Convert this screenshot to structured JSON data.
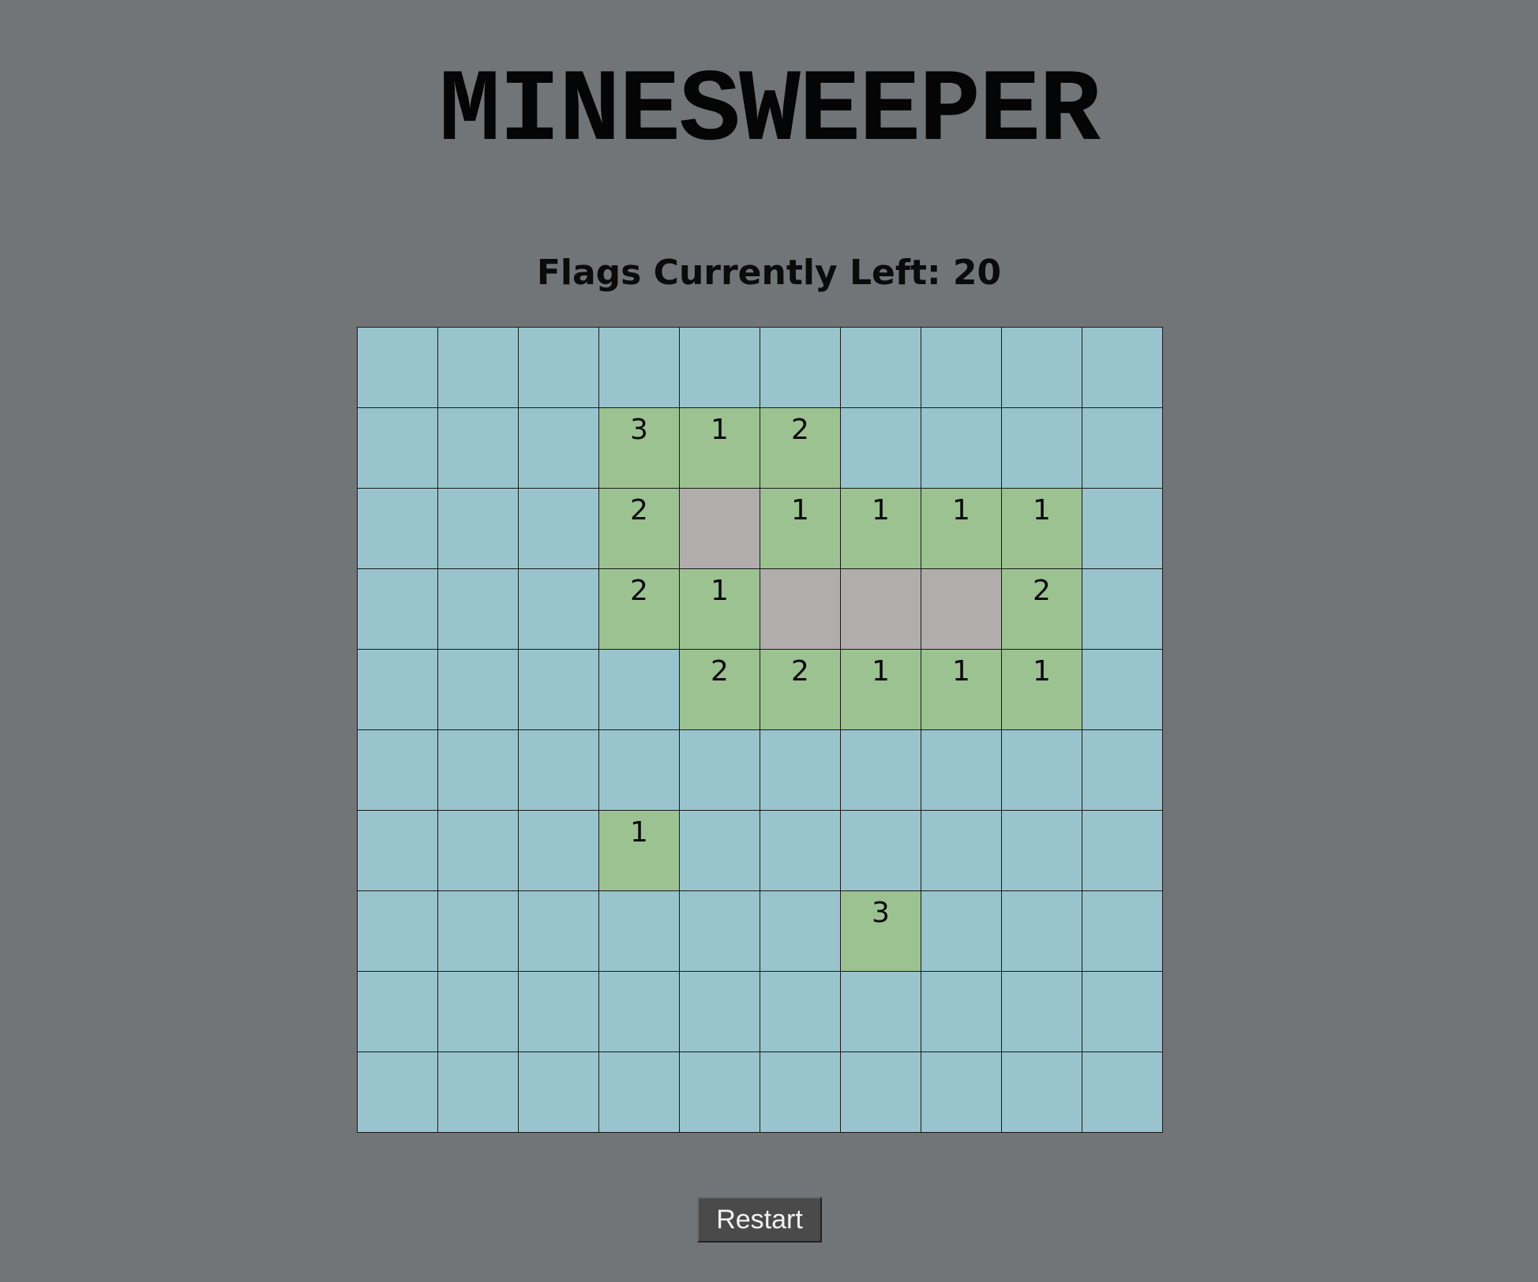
{
  "title": "MINESWEEPER",
  "flags_text": "Flags Currently Left: 20",
  "restart_label": "Restart",
  "colors": {
    "background": "#727577",
    "hidden_cell": "#99c4cd",
    "number_cell": "#9cc291",
    "empty_cell": "#b2adad",
    "button": "#4a4a4a"
  },
  "board": {
    "rows": 10,
    "cols": 10,
    "cells": [
      [
        "h",
        "h",
        "h",
        "h",
        "h",
        "h",
        "h",
        "h",
        "h",
        "h"
      ],
      [
        "h",
        "h",
        "h",
        "3",
        "1",
        "2",
        "h",
        "h",
        "h",
        "h"
      ],
      [
        "h",
        "h",
        "h",
        "2",
        "e",
        "1",
        "1",
        "1",
        "1",
        "h"
      ],
      [
        "h",
        "h",
        "h",
        "2",
        "1",
        "e",
        "e",
        "e",
        "2",
        "h"
      ],
      [
        "h",
        "h",
        "h",
        "h",
        "2",
        "2",
        "1",
        "1",
        "1",
        "h"
      ],
      [
        "h",
        "h",
        "h",
        "h",
        "h",
        "h",
        "h",
        "h",
        "h",
        "h"
      ],
      [
        "h",
        "h",
        "h",
        "1",
        "h",
        "h",
        "h",
        "h",
        "h",
        "h"
      ],
      [
        "h",
        "h",
        "h",
        "h",
        "h",
        "h",
        "3",
        "h",
        "h",
        "h"
      ],
      [
        "h",
        "h",
        "h",
        "h",
        "h",
        "h",
        "h",
        "h",
        "h",
        "h"
      ],
      [
        "h",
        "h",
        "h",
        "h",
        "h",
        "h",
        "h",
        "h",
        "h",
        "h"
      ]
    ]
  }
}
